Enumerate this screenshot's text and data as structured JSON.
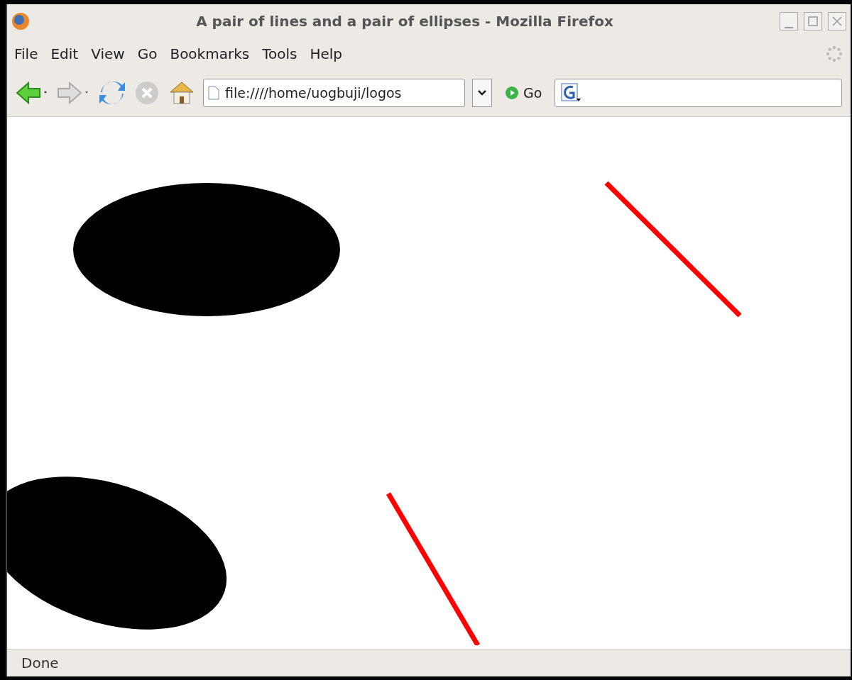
{
  "window": {
    "title": "A pair of lines and a pair of ellipses - Mozilla Firefox"
  },
  "menu": [
    "File",
    "Edit",
    "View",
    "Go",
    "Bookmarks",
    "Tools",
    "Help"
  ],
  "toolbar": {
    "address": "file:////home/uogbuji/logos",
    "go": "Go"
  },
  "status_bar": "Done"
}
